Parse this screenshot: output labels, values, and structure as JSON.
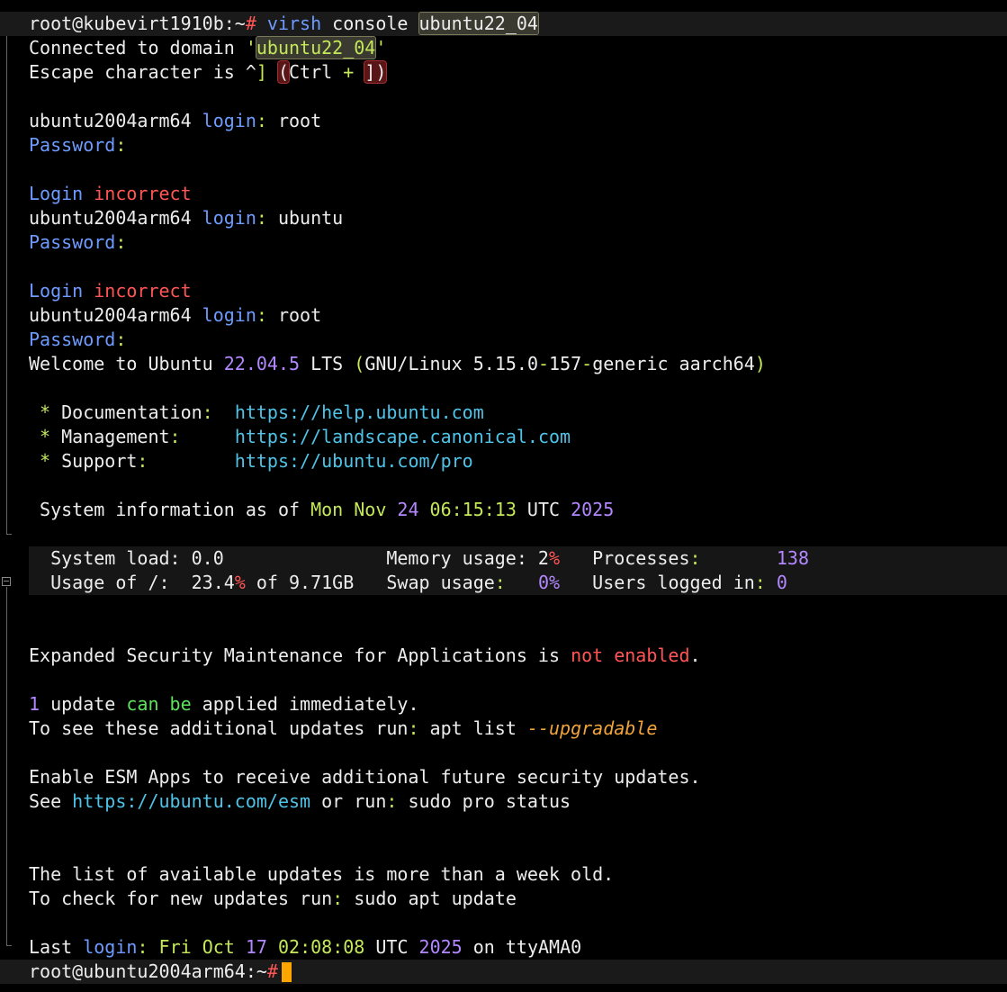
{
  "lines": [
    {
      "segs": [
        {
          "t": "root@kubevirt1910b:~",
          "c": "c-white"
        },
        {
          "t": "# ",
          "c": "c-red"
        },
        {
          "t": "virsh",
          "c": "c-blue"
        },
        {
          "t": " console ",
          "c": "c-white"
        },
        {
          "t": "ubuntu22_04",
          "c": "c-white sel"
        }
      ],
      "hl": true
    },
    {
      "segs": [
        {
          "t": "Connected to domain ",
          "c": "c-white"
        },
        {
          "t": "'",
          "c": "c-lime"
        },
        {
          "t": "ubuntu22_04",
          "c": "c-lime sel"
        },
        {
          "t": "'",
          "c": "c-lime"
        }
      ]
    },
    {
      "segs": [
        {
          "t": "Escape character is ^",
          "c": "c-white"
        },
        {
          "t": "]",
          "c": "c-lime"
        },
        {
          "t": " ",
          "c": "c-white"
        },
        {
          "t": "(",
          "c": "c-white selbox"
        },
        {
          "t": "Ctrl ",
          "c": "c-white"
        },
        {
          "t": "+",
          "c": "c-lime"
        },
        {
          "t": " ",
          "c": "c-white"
        },
        {
          "t": "])",
          "c": "c-white selbox"
        }
      ]
    },
    {
      "segs": []
    },
    {
      "segs": [
        {
          "t": "ubuntu2004arm64 ",
          "c": "c-white"
        },
        {
          "t": "login",
          "c": "c-blue"
        },
        {
          "t": ":",
          "c": "c-lime"
        },
        {
          "t": " root",
          "c": "c-white"
        }
      ]
    },
    {
      "segs": [
        {
          "t": "Password",
          "c": "c-blue"
        },
        {
          "t": ":",
          "c": "c-lime"
        }
      ]
    },
    {
      "segs": []
    },
    {
      "segs": [
        {
          "t": "Login ",
          "c": "c-blue"
        },
        {
          "t": "incorrect",
          "c": "c-red"
        }
      ]
    },
    {
      "segs": [
        {
          "t": "ubuntu2004arm64 ",
          "c": "c-white"
        },
        {
          "t": "login",
          "c": "c-blue"
        },
        {
          "t": ":",
          "c": "c-lime"
        },
        {
          "t": " ubuntu",
          "c": "c-white"
        }
      ]
    },
    {
      "segs": [
        {
          "t": "Password",
          "c": "c-blue"
        },
        {
          "t": ":",
          "c": "c-lime"
        }
      ]
    },
    {
      "segs": []
    },
    {
      "segs": [
        {
          "t": "Login ",
          "c": "c-blue"
        },
        {
          "t": "incorrect",
          "c": "c-red"
        }
      ]
    },
    {
      "segs": [
        {
          "t": "ubuntu2004arm64 ",
          "c": "c-white"
        },
        {
          "t": "login",
          "c": "c-blue"
        },
        {
          "t": ":",
          "c": "c-lime"
        },
        {
          "t": " root",
          "c": "c-white"
        }
      ]
    },
    {
      "segs": [
        {
          "t": "Password",
          "c": "c-blue"
        },
        {
          "t": ":",
          "c": "c-lime"
        }
      ]
    },
    {
      "segs": [
        {
          "t": "Welcome to Ubuntu ",
          "c": "c-white"
        },
        {
          "t": "22.04.5",
          "c": "c-purple"
        },
        {
          "t": " LTS ",
          "c": "c-white"
        },
        {
          "t": "(",
          "c": "c-lime"
        },
        {
          "t": "GNU/Linux ",
          "c": "c-white"
        },
        {
          "t": "5.15.0",
          "c": "c-white"
        },
        {
          "t": "-",
          "c": "c-lime"
        },
        {
          "t": "157",
          "c": "c-white"
        },
        {
          "t": "-",
          "c": "c-lime"
        },
        {
          "t": "generic aarch64",
          "c": "c-white"
        },
        {
          "t": ")",
          "c": "c-lime"
        }
      ]
    },
    {
      "segs": []
    },
    {
      "segs": [
        {
          "t": " * ",
          "c": "c-lime"
        },
        {
          "t": "Documentation",
          "c": "c-white"
        },
        {
          "t": ":",
          "c": "c-lime"
        },
        {
          "t": "  ",
          "c": "c-white"
        },
        {
          "t": "https://help.ubuntu.com",
          "c": "c-cyan"
        }
      ]
    },
    {
      "segs": [
        {
          "t": " * ",
          "c": "c-lime"
        },
        {
          "t": "Management",
          "c": "c-white"
        },
        {
          "t": ":",
          "c": "c-lime"
        },
        {
          "t": "     ",
          "c": "c-white"
        },
        {
          "t": "https://landscape.canonical.com",
          "c": "c-cyan"
        }
      ]
    },
    {
      "segs": [
        {
          "t": " * ",
          "c": "c-lime"
        },
        {
          "t": "Support",
          "c": "c-white"
        },
        {
          "t": ":",
          "c": "c-lime"
        },
        {
          "t": "        ",
          "c": "c-white"
        },
        {
          "t": "https://ubuntu.com/pro",
          "c": "c-cyan"
        }
      ]
    },
    {
      "segs": []
    },
    {
      "segs": [
        {
          "t": " System information as of ",
          "c": "c-white"
        },
        {
          "t": "Mon Nov ",
          "c": "c-lime"
        },
        {
          "t": "24",
          "c": "c-purple"
        },
        {
          "t": " 06:15:13",
          "c": "c-lime"
        },
        {
          "t": " UTC ",
          "c": "c-white"
        },
        {
          "t": "2025",
          "c": "c-purple"
        }
      ]
    },
    {
      "segs": []
    },
    {
      "segs": [
        {
          "t": "  System load: 0.0               Memory usage: 2",
          "c": "c-white"
        },
        {
          "t": "%",
          "c": "c-red"
        },
        {
          "t": "   Processes",
          "c": "c-white"
        },
        {
          "t": ":",
          "c": "c-lime"
        },
        {
          "t": "       ",
          "c": "c-white"
        },
        {
          "t": "138",
          "c": "c-purple"
        }
      ],
      "hl2": true
    },
    {
      "segs": [
        {
          "t": "  Usage of /:  23.4",
          "c": "c-white"
        },
        {
          "t": "%",
          "c": "c-red"
        },
        {
          "t": " of 9.71GB   Swap usage",
          "c": "c-white"
        },
        {
          "t": ":",
          "c": "c-lime"
        },
        {
          "t": "   ",
          "c": "c-white"
        },
        {
          "t": "0%",
          "c": "c-purple"
        },
        {
          "t": "   Users logged in",
          "c": "c-white"
        },
        {
          "t": ":",
          "c": "c-lime"
        },
        {
          "t": " ",
          "c": "c-white"
        },
        {
          "t": "0",
          "c": "c-purple"
        }
      ],
      "hl2": true
    },
    {
      "segs": []
    },
    {
      "segs": []
    },
    {
      "segs": [
        {
          "t": "Expanded Security Maintenance for Applications is ",
          "c": "c-white"
        },
        {
          "t": "not enabled",
          "c": "c-red"
        },
        {
          "t": ".",
          "c": "c-white"
        }
      ]
    },
    {
      "segs": []
    },
    {
      "segs": [
        {
          "t": "1",
          "c": "c-purple"
        },
        {
          "t": " update ",
          "c": "c-white"
        },
        {
          "t": "can be",
          "c": "c-green"
        },
        {
          "t": " applied immediately.",
          "c": "c-white"
        }
      ]
    },
    {
      "segs": [
        {
          "t": "To see these additional updates run",
          "c": "c-white"
        },
        {
          "t": ":",
          "c": "c-lime"
        },
        {
          "t": " apt list ",
          "c": "c-white"
        },
        {
          "t": "--upgradable",
          "c": "c-orange c-ital"
        }
      ]
    },
    {
      "segs": []
    },
    {
      "segs": [
        {
          "t": "Enable ESM Apps to receive additional future security updates.",
          "c": "c-white"
        }
      ]
    },
    {
      "segs": [
        {
          "t": "See ",
          "c": "c-white"
        },
        {
          "t": "https://ubuntu.com/esm",
          "c": "c-cyan"
        },
        {
          "t": " or run",
          "c": "c-white"
        },
        {
          "t": ":",
          "c": "c-lime"
        },
        {
          "t": " sudo pro status",
          "c": "c-white"
        }
      ]
    },
    {
      "segs": []
    },
    {
      "segs": []
    },
    {
      "segs": [
        {
          "t": "The list of available updates is more than a week old.",
          "c": "c-white"
        }
      ]
    },
    {
      "segs": [
        {
          "t": "To check for new updates run",
          "c": "c-white"
        },
        {
          "t": ":",
          "c": "c-lime"
        },
        {
          "t": " sudo apt update",
          "c": "c-white"
        }
      ]
    },
    {
      "segs": []
    },
    {
      "segs": [
        {
          "t": "Last ",
          "c": "c-white"
        },
        {
          "t": "login",
          "c": "c-blue"
        },
        {
          "t": ":",
          "c": "c-lime"
        },
        {
          "t": " Fri Oct ",
          "c": "c-lime"
        },
        {
          "t": "17",
          "c": "c-purple"
        },
        {
          "t": " 02:08:08",
          "c": "c-lime"
        },
        {
          "t": " UTC ",
          "c": "c-white"
        },
        {
          "t": "2025",
          "c": "c-purple"
        },
        {
          "t": " on ttyAMA0",
          "c": "c-white"
        }
      ]
    },
    {
      "segs": [
        {
          "t": "root@ubuntu2004arm64:~",
          "c": "c-white"
        },
        {
          "t": "#",
          "c": "c-red"
        }
      ],
      "hl": true,
      "cursor": true
    }
  ]
}
